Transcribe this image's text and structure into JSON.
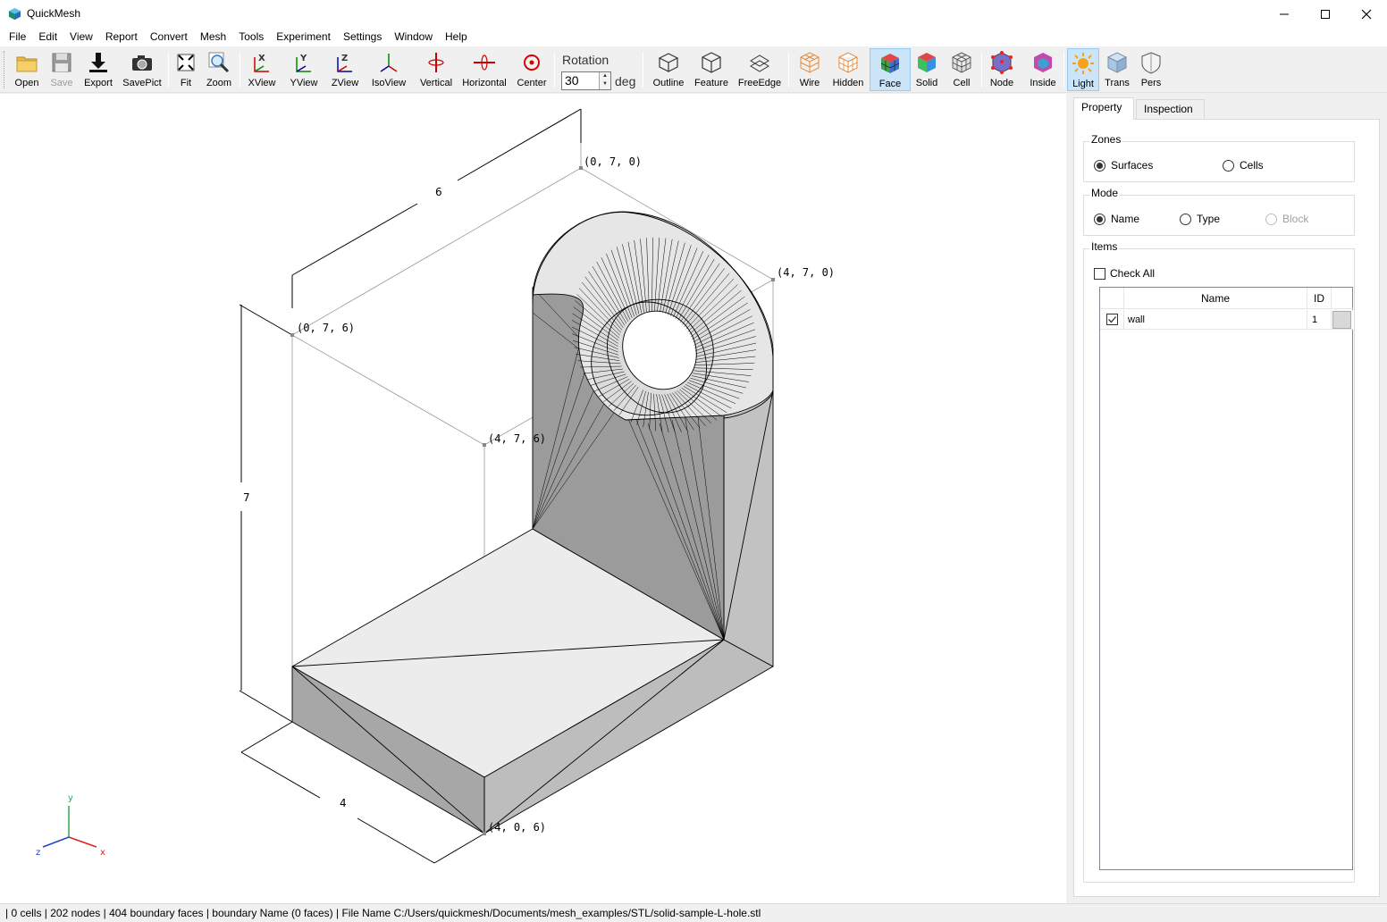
{
  "window": {
    "title": "QuickMesh"
  },
  "menu": [
    "File",
    "Edit",
    "View",
    "Report",
    "Convert",
    "Mesh",
    "Tools",
    "Experiment",
    "Settings",
    "Window",
    "Help"
  ],
  "toolbar": {
    "open": "Open",
    "save": "Save",
    "export": "Export",
    "savepict": "SavePict",
    "fit": "Fit",
    "zoom": "Zoom",
    "xview": "XView",
    "yview": "YView",
    "zview": "ZView",
    "isoview": "IsoView",
    "vertical": "Vertical",
    "horizontal": "Horizontal",
    "center": "Center",
    "rotation_label": "Rotation",
    "rotation_value": "30",
    "rotation_unit": "deg",
    "outline": "Outline",
    "feature": "Feature",
    "freeedge": "FreeEdge",
    "wire": "Wire",
    "hidden": "Hidden",
    "face": "Face",
    "solid": "Solid",
    "cell": "Cell",
    "node": "Node",
    "inside": "Inside",
    "light": "Light",
    "trans": "Trans",
    "pers": "Pers"
  },
  "viewport": {
    "labels": {
      "p070": "(0, 7, 0)",
      "p470": "(4, 7, 0)",
      "p076": "(0, 7, 6)",
      "p476": "(4, 7, 6)",
      "p406": "(4, 0, 6)",
      "dim6": "6",
      "dim7": "7",
      "dim4": "4"
    },
    "axes": {
      "y": "y",
      "z": "z",
      "x": "x"
    }
  },
  "panel": {
    "tabs": {
      "property": "Property",
      "inspection": "Inspection"
    },
    "zones": {
      "title": "Zones",
      "surfaces": "Surfaces",
      "cells": "Cells"
    },
    "mode": {
      "title": "Mode",
      "name": "Name",
      "type": "Type",
      "block": "Block"
    },
    "items": {
      "title": "Items",
      "check_all": "Check All",
      "col_name": "Name",
      "col_id": "ID",
      "rows": [
        {
          "name": "wall",
          "id": "1"
        }
      ]
    }
  },
  "status": "| 0 cells | 202 nodes | 404 boundary faces |  boundary Name  (0 faces) | File Name C:/Users/quickmesh/Documents/mesh_examples/STL/solid-sample-L-hole.stl"
}
